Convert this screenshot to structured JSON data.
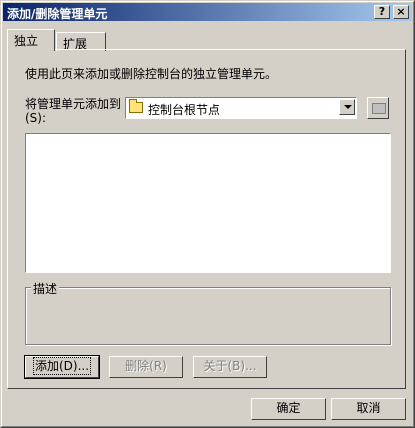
{
  "window": {
    "title": "添加/删除管理单元",
    "help_button": "?",
    "close_button": "×"
  },
  "tabs": [
    {
      "label": "独立",
      "active": true
    },
    {
      "label": "扩展",
      "active": false
    }
  ],
  "panel": {
    "description": "使用此页来添加或删除控制台的独立管理单元。",
    "add_to_label": "将管理单元添加到(S):",
    "add_to_selected": "控制台根节点",
    "group_title": "描述",
    "add_button": "添加(D)...",
    "remove_button": "删除(R)",
    "about_button": "关于(B)..."
  },
  "footer": {
    "ok_button": "确定",
    "cancel_button": "取消"
  },
  "colors": {
    "face": "#d4d0c8",
    "title_start": "#0a246a",
    "title_end": "#a6caf0"
  }
}
